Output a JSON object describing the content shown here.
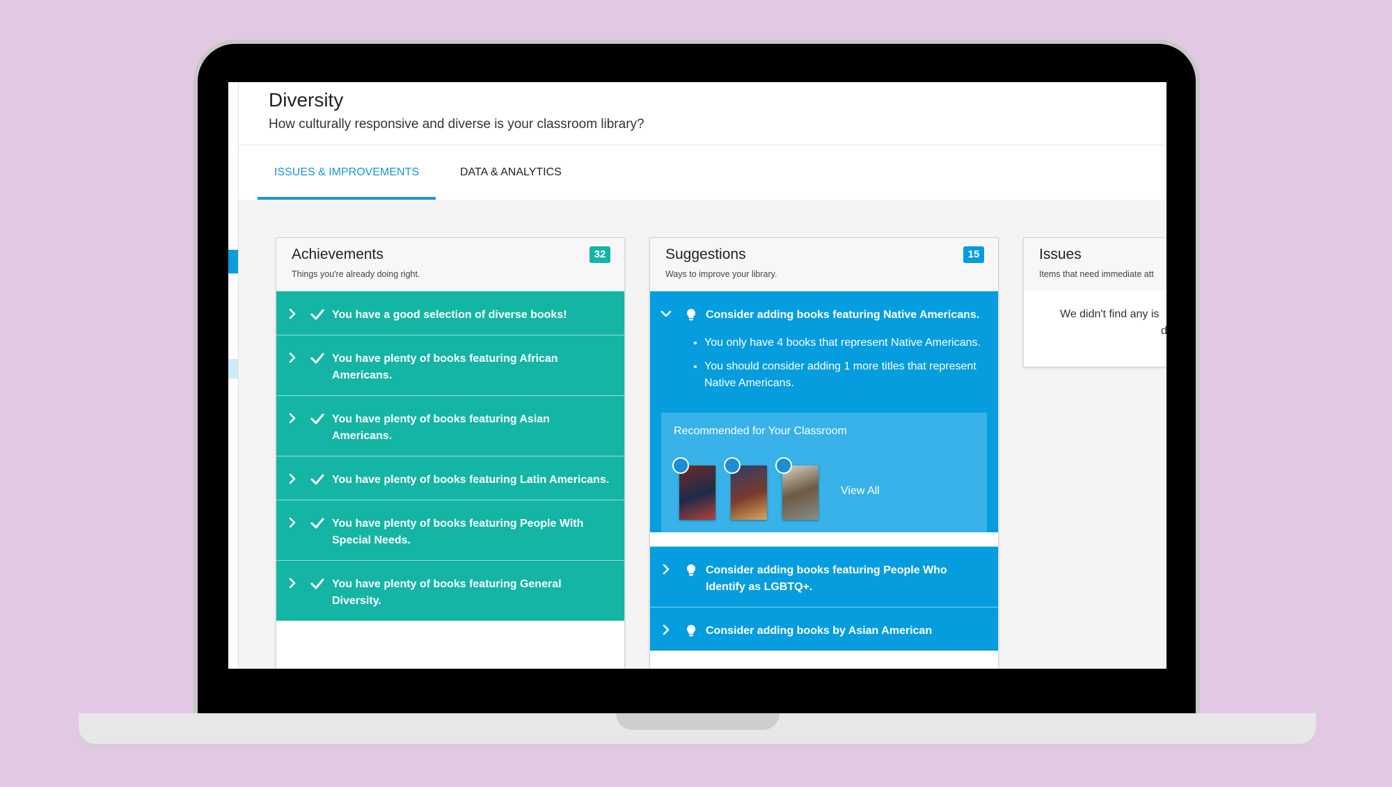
{
  "header": {
    "title": "Diversity",
    "subtitle": "How culturally responsive and diverse is your classroom library?"
  },
  "tabs": [
    {
      "label": "ISSUES & IMPROVEMENTS",
      "active": true
    },
    {
      "label": "DATA & ANALYTICS",
      "active": false
    }
  ],
  "colors": {
    "accent": "#1a95d4",
    "achievements": "#14b5a5",
    "suggestions": "#069dde"
  },
  "achievements": {
    "title": "Achievements",
    "subtitle": "Things you're already doing right.",
    "count": "32",
    "items": [
      "You have a good selection of diverse books!",
      "You have plenty of books featuring African Americans.",
      "You have plenty of books featuring Asian Americans.",
      "You have plenty of books featuring Latin Americans.",
      "You have plenty of books featuring People With Special Needs.",
      "You have plenty of books featuring General Diversity."
    ]
  },
  "suggestions": {
    "title": "Suggestions",
    "subtitle": "Ways to improve your library.",
    "count": "15",
    "expanded": {
      "title": "Consider adding books featuring Native Americans.",
      "bullets": [
        "You only have 4 books that represent Native Americans.",
        "You should consider adding 1 more titles that represent Native Americans."
      ],
      "recommended_title": "Recommended for Your Classroom",
      "view_all": "View All"
    },
    "items": [
      "Consider adding books featuring People Who Identify as LGBTQ+.",
      "Consider adding books by Asian American"
    ]
  },
  "issues": {
    "title": "Issues",
    "subtitle": "Items that need immediate att",
    "empty_line1": "We didn't find any is",
    "empty_line2": "dive"
  }
}
